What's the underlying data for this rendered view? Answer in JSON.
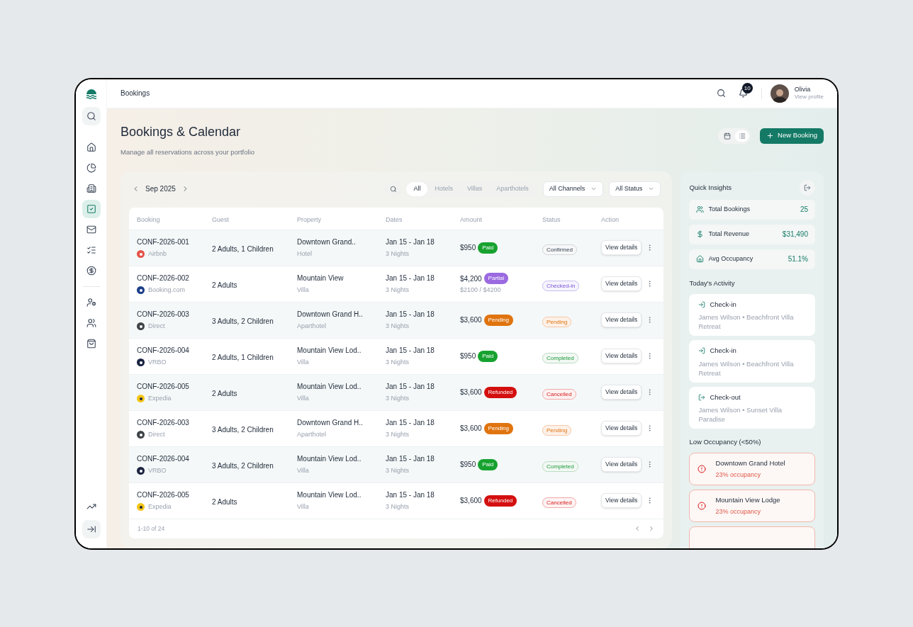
{
  "topbar": {
    "title": "Bookings",
    "notifications": "10",
    "user": {
      "name": "Olivia",
      "link": "View profile"
    }
  },
  "sidebar": {
    "items": [
      {
        "kind": "search",
        "selected": false
      },
      {
        "kind": "home",
        "selected": false
      },
      {
        "kind": "reports",
        "selected": false
      },
      {
        "kind": "properties",
        "selected": false
      },
      {
        "kind": "bookings",
        "selected": true
      },
      {
        "kind": "messages",
        "selected": false
      },
      {
        "kind": "tasks",
        "selected": false
      },
      {
        "kind": "finance",
        "selected": false
      }
    ],
    "people": [
      {
        "kind": "owners",
        "selected": false
      },
      {
        "kind": "guests",
        "selected": false
      },
      {
        "kind": "shop",
        "selected": false
      }
    ],
    "bottom": [
      {
        "kind": "trends",
        "selected": false
      },
      {
        "kind": "collapse",
        "selected": false
      }
    ]
  },
  "header": {
    "title": "Bookings & Calendar",
    "subtitle": "Manage all reservations across your portfolio",
    "views": [
      {
        "kind": "calendar",
        "selected": false
      },
      {
        "kind": "list",
        "selected": true
      }
    ],
    "new_button": "New Booking"
  },
  "toolbar": {
    "month": "Sep 2025",
    "tabs": [
      {
        "label": "All",
        "selected": true
      },
      {
        "label": "Hotels",
        "selected": false
      },
      {
        "label": "Villas",
        "selected": false
      },
      {
        "label": "Aparthotels",
        "selected": false
      }
    ],
    "filters": [
      "All Channels",
      "All Status"
    ]
  },
  "table": {
    "columns": [
      "Booking",
      "Guest",
      "Property",
      "Dates",
      "Amount",
      "Status",
      "Action"
    ],
    "rows": [
      {
        "booking": "CONF-2026-001",
        "channel": {
          "kind": "airbnb",
          "label": "Airbnb"
        },
        "guest": "2 Adults, 1 Children",
        "property": "Downtown Grand..",
        "property_type": "Hotel",
        "dates": "Jan 15 - Jan 18",
        "nights": "3 Nights",
        "amount": "$950",
        "payment": {
          "kind": "paid",
          "label": "Paid"
        },
        "status": {
          "kind": "confirmed",
          "label": "Confirmed"
        },
        "action": "View details"
      },
      {
        "booking": "CONF-2026-002",
        "channel": {
          "kind": "booking",
          "label": "Booking.com"
        },
        "guest": "2 Adults",
        "property": "Mountain View",
        "property_type": "Villa",
        "dates": "Jan 15 - Jan 18",
        "nights": "3 Nights",
        "amount": "$4,200",
        "payment": {
          "kind": "partial",
          "label": "Partial"
        },
        "amount_note": "$2100 / $4200",
        "status": {
          "kind": "checked_in",
          "label": "Checked-in"
        },
        "action": "View details"
      },
      {
        "booking": "CONF-2026-003",
        "channel": {
          "kind": "direct",
          "label": "Direct"
        },
        "guest": "3 Adults, 2 Children",
        "property": "Downtown Grand H..",
        "property_type": "Aparthotel",
        "dates": "Jan 15 - Jan 18",
        "nights": "3 Nights",
        "amount": "$3,600",
        "payment": {
          "kind": "pending",
          "label": "Pending"
        },
        "status": {
          "kind": "pending",
          "label": "Pending"
        },
        "action": "View details"
      },
      {
        "booking": "CONF-2026-004",
        "channel": {
          "kind": "vrbo",
          "label": "VRBO"
        },
        "guest": "2 Adults, 1 Children",
        "property": "Mountain View Lod..",
        "property_type": "Villa",
        "dates": "Jan 15 - Jan 18",
        "nights": "3 Nights",
        "amount": "$950",
        "payment": {
          "kind": "paid",
          "label": "Paid"
        },
        "status": {
          "kind": "completed",
          "label": "Completed"
        },
        "action": "View details"
      },
      {
        "booking": "CONF-2026-005",
        "channel": {
          "kind": "expedia",
          "label": "Expedia"
        },
        "guest": "2 Adults",
        "property": "Mountain View Lod..",
        "property_type": "Villa",
        "dates": "Jan 15 - Jan 18",
        "nights": "3 Nights",
        "amount": "$3,600",
        "payment": {
          "kind": "refunded",
          "label": "Refunded"
        },
        "status": {
          "kind": "cancelled",
          "label": "Cancelled"
        },
        "action": "View details"
      },
      {
        "booking": "CONF-2026-003",
        "channel": {
          "kind": "direct",
          "label": "Direct"
        },
        "guest": "3 Adults, 2 Children",
        "property": "Downtown Grand H..",
        "property_type": "Aparthotel",
        "dates": "Jan 15 - Jan 18",
        "nights": "3 Nights",
        "amount": "$3,600",
        "payment": {
          "kind": "pending",
          "label": "Pending"
        },
        "status": {
          "kind": "pending",
          "label": "Pending"
        },
        "action": "View details"
      },
      {
        "booking": "CONF-2026-004",
        "channel": {
          "kind": "vrbo",
          "label": "VRBO"
        },
        "guest": "3 Adults, 2 Children",
        "property": "Mountain View Lod..",
        "property_type": "Villa",
        "dates": "Jan 15 - Jan 18",
        "nights": "3 Nights",
        "amount": "$950",
        "payment": {
          "kind": "paid",
          "label": "Paid"
        },
        "status": {
          "kind": "completed",
          "label": "Completed"
        },
        "action": "View details"
      },
      {
        "booking": "CONF-2026-005",
        "channel": {
          "kind": "expedia",
          "label": "Expedia"
        },
        "guest": "2 Adults",
        "property": "Mountain View Lod..",
        "property_type": "Villa",
        "dates": "Jan 15 - Jan 18",
        "nights": "3 Nights",
        "amount": "$3,600",
        "payment": {
          "kind": "refunded",
          "label": "Refunded"
        },
        "status": {
          "kind": "cancelled",
          "label": "Cancelled"
        },
        "action": "View details"
      }
    ],
    "pagination": "1-10 of 24"
  },
  "insights": {
    "title": "Quick Insights",
    "stats": [
      {
        "kind": "bookings",
        "label": "Total Bookings",
        "value": "25"
      },
      {
        "kind": "revenue",
        "label": "Total Revenue",
        "value": "$31,490"
      },
      {
        "kind": "occupancy",
        "label": "Avg Occupancy",
        "value": "51.1%"
      }
    ],
    "activity_title": "Today's Activity",
    "activity": [
      {
        "kind": "check_in",
        "title": "Check-in",
        "detail": "James Wilson • Beachfront Villa Retreat"
      },
      {
        "kind": "check_in",
        "title": "Check-in",
        "detail": "James Wilson • Beachfront Villa Retreat"
      },
      {
        "kind": "check_out",
        "title": "Check-out",
        "detail": "James Wilson • Sunset Villa Paradise"
      }
    ],
    "low_title": "Low Occupancy (<50%)",
    "low": [
      {
        "kind": "full",
        "name": "Downtown Grand Hotel",
        "note": "23% occupancy"
      },
      {
        "kind": "full",
        "name": "Mountain View Lodge",
        "note": "23% occupancy"
      },
      {
        "kind": "cut"
      }
    ]
  }
}
